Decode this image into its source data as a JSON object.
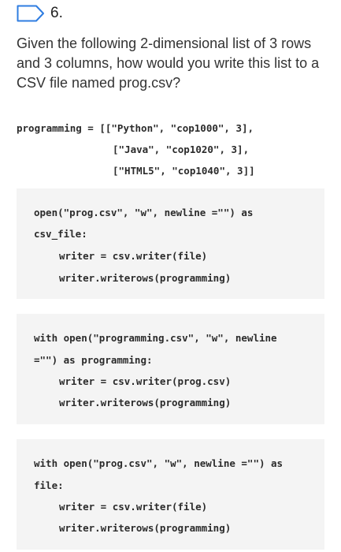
{
  "question": {
    "number": "6.",
    "text": "Given the following 2-dimensional list of 3 rows and 3 columns, how would you write this list to a CSV file named prog.csv?"
  },
  "given_code": {
    "line1": "programming = [[\"Python\", \"cop1000\", 3],",
    "line2": "[\"Java\", \"cop1020\", 3],",
    "line3": "[\"HTML5\", \"cop1040\", 3]]"
  },
  "options": [
    {
      "lines": [
        "open(\"prog.csv\", \"w\", newline =\"\") as",
        "csv_file:",
        "writer = csv.writer(file)",
        "writer.writerows(programming)"
      ]
    },
    {
      "lines": [
        "with open(\"programming.csv\", \"w\", newline",
        "=\"\") as programming:",
        "writer = csv.writer(prog.csv)",
        "writer.writerows(programming)"
      ]
    },
    {
      "lines": [
        "with open(\"prog.csv\", \"w\", newline =\"\") as",
        "file:",
        "writer = csv.writer(file)",
        "writer.writerows(programming)"
      ]
    }
  ],
  "colors": {
    "flag_outline": "#2f7de1",
    "option_background": "#f4f4f4",
    "text": "#333333"
  }
}
